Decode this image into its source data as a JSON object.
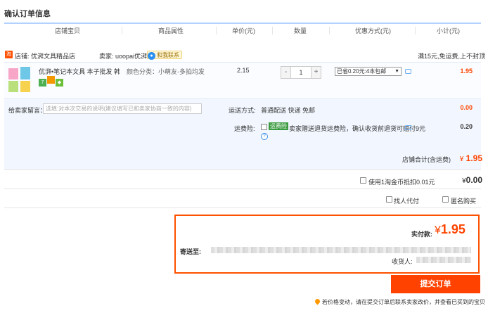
{
  "page": {
    "title": "确认订单信息"
  },
  "columns": [
    "店铺宝贝",
    "商品属性",
    "单价(元)",
    "数量",
    "优惠方式(元)",
    "小计(元)"
  ],
  "shop": {
    "icon_text": "淘",
    "name_label": "店铺: 优湃文具精品店",
    "seller_label": "卖家: uoopai优湃",
    "contact_label": "和我联系",
    "promo_text": "满15元,免运费,上不封顶"
  },
  "item": {
    "name": "优湃•笔记本文具 本子批发 韩...",
    "sku": "颜色分类：小萌友-多拍均发",
    "price": "2.15",
    "quantity": "1",
    "minus": "-",
    "plus": "+",
    "discount_option": "已省0.20元:4本包邮",
    "subtotal": "1.95",
    "badges": [
      "7",
      "",
      ""
    ]
  },
  "memo": {
    "label": "给卖家留言：",
    "placeholder": "选填:对本次交易的说明(建议填写已和卖家协商一致的内容)"
  },
  "shipping": {
    "label": "运送方式:",
    "value": "普通配送 快递 免邮",
    "fee": "0.00"
  },
  "insurance": {
    "label": "运费险:",
    "tag": "运费险",
    "text": "卖家赠送退货运费险，确认收货前退货可赔付9元",
    "q": "?",
    "fee": "0.20"
  },
  "shop_total": {
    "label": "店铺合计(含运费)",
    "currency": "¥",
    "value": "1.95"
  },
  "coin": {
    "label": "使用1淘金币抵扣0.01元",
    "currency": "¥",
    "value": "0.00"
  },
  "options": {
    "pay_for_me": "找人代付",
    "anonymous": "匿名购买"
  },
  "confirm": {
    "paid_label": "实付款:",
    "currency": "¥",
    "paid_value": "1.95",
    "address_label": "寄送至:",
    "receiver_label": "收货人:"
  },
  "submit_label": "提交订单",
  "notice": "若价格变动，请在提交订单后联系卖家改价，并查看已买到的宝贝",
  "colors": {
    "accent": "#ff4200",
    "price": "#ff4400",
    "header_line": "#b2d1ff",
    "row_bg": "#f2f7ff"
  }
}
